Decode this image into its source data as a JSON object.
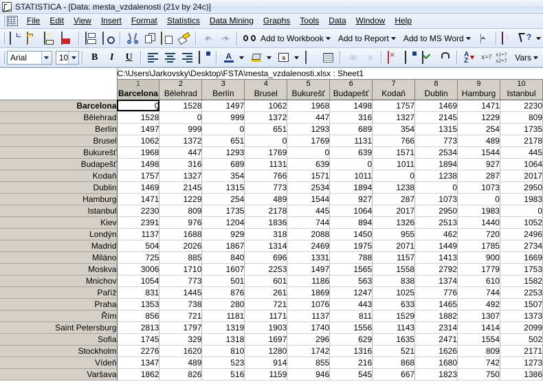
{
  "window": {
    "title": "STATISTICA - [Data: mesta_vzdalenosti (21v by 24c)]",
    "app_icon": "statistica-icon"
  },
  "menu": {
    "sheet_icon": "datasheet-icon",
    "items": [
      {
        "label": "File"
      },
      {
        "label": "Edit"
      },
      {
        "label": "View"
      },
      {
        "label": "Insert"
      },
      {
        "label": "Format"
      },
      {
        "label": "Statistics"
      },
      {
        "label": "Data Mining"
      },
      {
        "label": "Graphs"
      },
      {
        "label": "Tools"
      },
      {
        "label": "Data"
      },
      {
        "label": "Window"
      },
      {
        "label": "Help"
      }
    ]
  },
  "toolbar_main": {
    "buttons": [
      {
        "name": "new-document-icon",
        "icon": "doc"
      },
      {
        "name": "open-folder-icon",
        "icon": "open"
      },
      {
        "name": "save-icon",
        "icon": "save"
      },
      {
        "name": "export-pdf-icon",
        "icon": "pdf"
      },
      {
        "name": "print-icon",
        "icon": "print"
      },
      {
        "name": "print-preview-icon",
        "icon": "preview"
      },
      {
        "name": "cut-icon",
        "icon": "cut"
      },
      {
        "name": "copy-icon",
        "icon": "copy"
      },
      {
        "name": "paste-icon",
        "icon": "paste"
      },
      {
        "name": "format-painter-icon",
        "icon": "brush"
      },
      {
        "name": "undo-icon",
        "icon": "undo"
      },
      {
        "name": "redo-icon",
        "icon": "redo"
      },
      {
        "name": "find-binoculars-icon",
        "icon": "find"
      }
    ],
    "add_to_workbook": "Add to Workbook",
    "add_to_report": "Add to Report",
    "add_to_ms_word": "Add to MS Word",
    "auto_icon": "auto-update-icon",
    "book_icon": "statistics-book-icon",
    "help_icon": "context-help-icon"
  },
  "toolbar_format": {
    "font_name": "Arial",
    "font_size": "10",
    "bold": "B",
    "italic": "I",
    "underline": "U",
    "align_left_icon": "align-left-icon",
    "align_center_icon": "align-center-icon",
    "align_right_icon": "align-right-icon",
    "cell_properties_icon": "cell-properties-icon",
    "font_color_icon": "font-color-icon",
    "fill_color_icon": "fill-color-icon",
    "border_icon": "border-icon",
    "text_label": "A",
    "label_tag_icon": "text-labels-icon",
    "grid_icon": "show-grid-icon",
    "increase_decimal": ".00",
    "decrease_decimal": ".0",
    "add_vars_icon": "add-variables-icon",
    "variable_spec_icon": "variable-specs-icon",
    "case_spec_icon": "case-specs-icon",
    "lock_icon": "lock-icon",
    "sort_icon": "sort-az-icon",
    "xeq": "x=?",
    "x1x2": "x1=? x2=?",
    "vars_label": "Vars"
  },
  "sheet": {
    "path": "C:\\Users\\Jarkovsky\\Desktop\\FSTA\\mesta_vzdalenosti.xlsx : Sheet1",
    "selected_col_index": 0,
    "selected_row_index": 0,
    "columns": [
      {
        "num": "1",
        "name": "Barcelona"
      },
      {
        "num": "2",
        "name": "Bělehrad"
      },
      {
        "num": "3",
        "name": "Berlín"
      },
      {
        "num": "4",
        "name": "Brusel"
      },
      {
        "num": "5",
        "name": "Bukurešť"
      },
      {
        "num": "6",
        "name": "Budapešť"
      },
      {
        "num": "7",
        "name": "Kodaň"
      },
      {
        "num": "8",
        "name": "Dublin"
      },
      {
        "num": "9",
        "name": "Hamburg"
      },
      {
        "num": "10",
        "name": "Istanbul"
      }
    ],
    "rows": [
      {
        "name": "Barcelona",
        "values": [
          0,
          1528,
          1497,
          1062,
          1968,
          1498,
          1757,
          1469,
          1471,
          2230
        ]
      },
      {
        "name": "Bělehrad",
        "values": [
          1528,
          0,
          999,
          1372,
          447,
          316,
          1327,
          2145,
          1229,
          809
        ]
      },
      {
        "name": "Berlín",
        "values": [
          1497,
          999,
          0,
          651,
          1293,
          689,
          354,
          1315,
          254,
          1735
        ]
      },
      {
        "name": "Brusel",
        "values": [
          1062,
          1372,
          651,
          0,
          1769,
          1131,
          766,
          773,
          489,
          2178
        ]
      },
      {
        "name": "Bukurešť",
        "values": [
          1968,
          447,
          1293,
          1769,
          0,
          639,
          1571,
          2534,
          1544,
          445
        ]
      },
      {
        "name": "Budapešť",
        "values": [
          1498,
          316,
          689,
          1131,
          639,
          0,
          1011,
          1894,
          927,
          1064
        ]
      },
      {
        "name": "Kodaň",
        "values": [
          1757,
          1327,
          354,
          766,
          1571,
          1011,
          0,
          1238,
          287,
          2017
        ]
      },
      {
        "name": "Dublin",
        "values": [
          1469,
          2145,
          1315,
          773,
          2534,
          1894,
          1238,
          0,
          1073,
          2950
        ]
      },
      {
        "name": "Hamburg",
        "values": [
          1471,
          1229,
          254,
          489,
          1544,
          927,
          287,
          1073,
          0,
          1983
        ]
      },
      {
        "name": "Istanbul",
        "values": [
          2230,
          809,
          1735,
          2178,
          445,
          1064,
          2017,
          2950,
          1983,
          0
        ]
      },
      {
        "name": "Kiev",
        "values": [
          2391,
          976,
          1204,
          1836,
          744,
          894,
          1326,
          2513,
          1440,
          1052
        ]
      },
      {
        "name": "Londýn",
        "values": [
          1137,
          1688,
          929,
          318,
          2088,
          1450,
          955,
          462,
          720,
          2496
        ]
      },
      {
        "name": "Madrid",
        "values": [
          504,
          2026,
          1867,
          1314,
          2469,
          1975,
          2071,
          1449,
          1785,
          2734
        ]
      },
      {
        "name": "Miláno",
        "values": [
          725,
          885,
          840,
          696,
          1331,
          788,
          1157,
          1413,
          900,
          1669
        ]
      },
      {
        "name": "Moskva",
        "values": [
          3006,
          1710,
          1607,
          2253,
          1497,
          1565,
          1558,
          2792,
          1779,
          1753
        ]
      },
      {
        "name": "Mnichov",
        "values": [
          1054,
          773,
          501,
          601,
          1186,
          563,
          838,
          1374,
          610,
          1582
        ]
      },
      {
        "name": "Paříž",
        "values": [
          831,
          1445,
          876,
          261,
          1869,
          1247,
          1025,
          776,
          744,
          2253
        ]
      },
      {
        "name": "Praha",
        "values": [
          1353,
          738,
          280,
          721,
          1076,
          443,
          633,
          1465,
          492,
          1507
        ]
      },
      {
        "name": "Řím",
        "values": [
          856,
          721,
          1181,
          1171,
          1137,
          811,
          1529,
          1882,
          1307,
          1373
        ]
      },
      {
        "name": "Saint Petersburg",
        "values": [
          2813,
          1797,
          1319,
          1903,
          1740,
          1556,
          1143,
          2314,
          1414,
          2099
        ]
      },
      {
        "name": "Sofia",
        "values": [
          1745,
          329,
          1318,
          1697,
          296,
          629,
          1635,
          2471,
          1554,
          502
        ]
      },
      {
        "name": "Stockholm",
        "values": [
          2276,
          1620,
          810,
          1280,
          1742,
          1316,
          521,
          1626,
          809,
          2171
        ]
      },
      {
        "name": "Vídeň",
        "values": [
          1347,
          489,
          523,
          914,
          855,
          216,
          868,
          1680,
          742,
          1273
        ]
      },
      {
        "name": "Varšava",
        "values": [
          1862,
          826,
          516,
          1159,
          946,
          545,
          667,
          1823,
          750,
          1386
        ]
      }
    ]
  },
  "colors": {
    "titlebar": "#e2ebf8",
    "toolbar": "#e7eef9",
    "header_gray": "#d4d0c8",
    "cell_bg": "#ffffff"
  }
}
